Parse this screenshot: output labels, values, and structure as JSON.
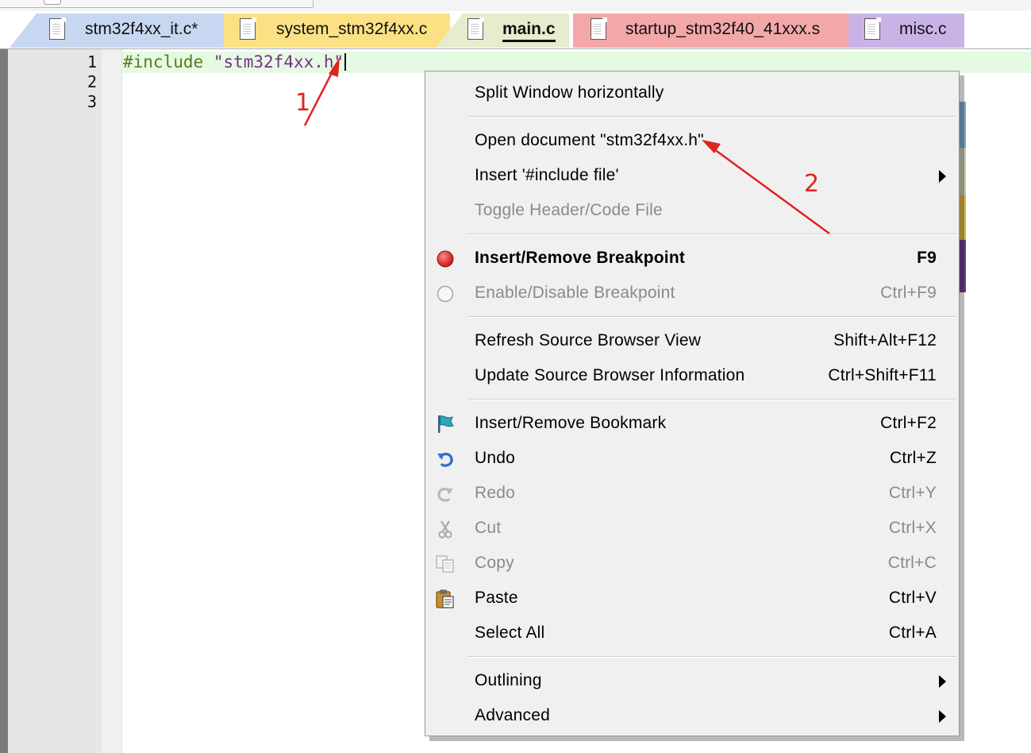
{
  "tabs": [
    {
      "label": "stm32f4xx_it.c*",
      "color": "#c8d7f1",
      "active": false
    },
    {
      "label": "system_stm32f4xx.c",
      "color": "#fbe184",
      "active": false
    },
    {
      "label": "main.c",
      "color": "#e6edcf",
      "active": true
    },
    {
      "label": "startup_stm32f40_41xxx.s",
      "color": "#f3a7a9",
      "active": false
    },
    {
      "label": "misc.c",
      "color": "#c9b3e6",
      "active": false
    }
  ],
  "editor": {
    "line_numbers": [
      "1",
      "2",
      "3"
    ],
    "line1": {
      "keyword": "#include",
      "string": "\"stm32f4xx.h\""
    }
  },
  "context_menu": {
    "items": [
      {
        "label": "Split Window horizontally",
        "shortcut": "",
        "enabled": true
      },
      {
        "label": "Open document \"stm32f4xx.h\"",
        "shortcut": "",
        "enabled": true
      },
      {
        "label": "Insert '#include file'",
        "shortcut": "",
        "enabled": true,
        "submenu": true
      },
      {
        "label": "Toggle Header/Code File",
        "shortcut": "",
        "enabled": false
      },
      {
        "label": "Insert/Remove Breakpoint",
        "shortcut": "F9",
        "enabled": true,
        "icon": "breakpoint-icon"
      },
      {
        "label": "Enable/Disable Breakpoint",
        "shortcut": "Ctrl+F9",
        "enabled": false,
        "icon": "breakpoint-disabled-icon"
      },
      {
        "label": "Refresh Source Browser View",
        "shortcut": "Shift+Alt+F12",
        "enabled": true
      },
      {
        "label": "Update Source Browser Information",
        "shortcut": "Ctrl+Shift+F11",
        "enabled": true
      },
      {
        "label": "Insert/Remove Bookmark",
        "shortcut": "Ctrl+F2",
        "enabled": true,
        "icon": "bookmark-flag-icon"
      },
      {
        "label": "Undo",
        "shortcut": "Ctrl+Z",
        "enabled": true,
        "icon": "undo-icon"
      },
      {
        "label": "Redo",
        "shortcut": "Ctrl+Y",
        "enabled": false,
        "icon": "redo-icon"
      },
      {
        "label": "Cut",
        "shortcut": "Ctrl+X",
        "enabled": false,
        "icon": "scissors-icon"
      },
      {
        "label": "Copy",
        "shortcut": "Ctrl+C",
        "enabled": false,
        "icon": "copy-icon"
      },
      {
        "label": "Paste",
        "shortcut": "Ctrl+V",
        "enabled": true,
        "icon": "paste-icon"
      },
      {
        "label": "Select All",
        "shortcut": "Ctrl+A",
        "enabled": true
      },
      {
        "label": "Outlining",
        "shortcut": "",
        "enabled": true,
        "submenu": true
      },
      {
        "label": "Advanced",
        "shortcut": "",
        "enabled": true,
        "submenu": true
      }
    ]
  },
  "annotations": {
    "label1": "1",
    "label2": "2",
    "color": "#e0241e"
  }
}
